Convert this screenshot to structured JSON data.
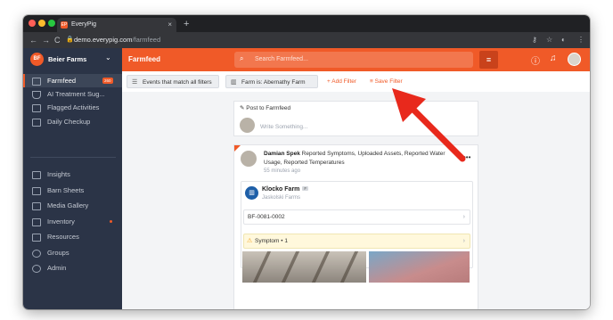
{
  "browser": {
    "tab_title": "EveryPig",
    "tab_favicon": "EP",
    "tab_close": "×",
    "new_tab": "+",
    "url_host": "demo.everypig.com",
    "url_path": "/farmfeed",
    "nav_back": "←",
    "nav_forward": "→",
    "nav_reload": "C",
    "lock_icon": "lock-icon"
  },
  "sidebar": {
    "farm_initials": "BF",
    "farm_name": "Beier Farms",
    "items": [
      {
        "label": "Farmfeed",
        "badge": "260",
        "active": true
      },
      {
        "label": "AI Treatment Sug..."
      },
      {
        "label": "Flagged Activities"
      },
      {
        "label": "Daily Checkup"
      },
      {
        "label": "Insights"
      },
      {
        "label": "Barn Sheets"
      },
      {
        "label": "Media Gallery"
      },
      {
        "label": "Inventory",
        "dot": true
      },
      {
        "label": "Resources"
      },
      {
        "label": "Groups"
      },
      {
        "label": "Admin"
      }
    ]
  },
  "topbar": {
    "title": "Farmfeed",
    "search_placeholder": "Search Farmfeed...",
    "icons": [
      "filter-icon",
      "help-icon",
      "bell-icon",
      "avatar"
    ]
  },
  "filters": {
    "match_label": "Events that match all filters",
    "farm_chip": "Farm is: Abernathy Farm",
    "add_filter": "+ Add Filter",
    "save_filter": "Save Filter"
  },
  "post_box": {
    "header": "Post to Farmfeed",
    "placeholder": "Write Something..."
  },
  "feed_item": {
    "author": "Damian Spek",
    "action": "Reported Symptoms, Uploaded Assets, Reported Water Usage, Reported Temperatures",
    "time_ago": "55 minutes ago",
    "more": "•••",
    "farm_name": "Klocko Farm",
    "farm_tag": "F",
    "farm_owner": "Jaskolski Farms",
    "group_id": "BF-0081-0002",
    "symptom": "Symptom • 1"
  },
  "colors": {
    "accent": "#f05a28",
    "sidebar_bg": "#2b3447",
    "annotation_arrow": "#e8291c"
  }
}
